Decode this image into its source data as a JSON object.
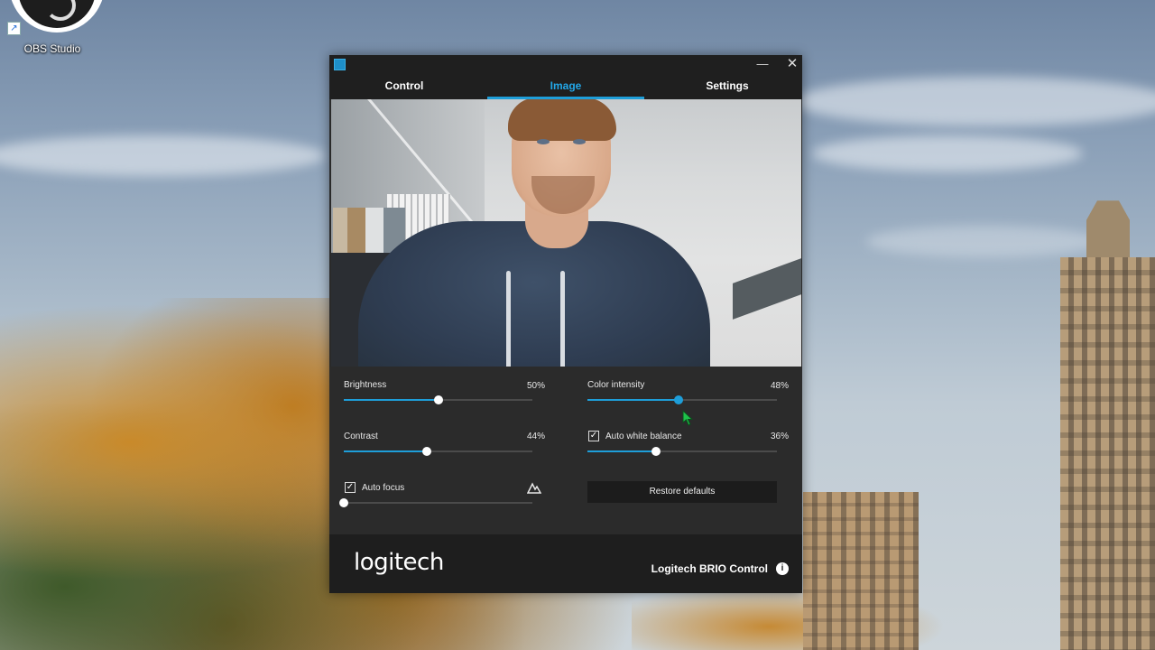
{
  "desktop": {
    "icon_label": "OBS Studio",
    "icon": "obs-studio-icon",
    "shortcut_icon": "shortcut-arrow-icon"
  },
  "window": {
    "app_icon": "logitech-app-icon",
    "min_glyph": "—",
    "close_glyph": "✕",
    "tabs": [
      {
        "label": "Control",
        "active": false
      },
      {
        "label": "Image",
        "active": true
      },
      {
        "label": "Settings",
        "active": false
      }
    ],
    "accent_color": "#1e9ed9"
  },
  "controls": {
    "brightness": {
      "label": "Brightness",
      "value_text": "50%",
      "value": 0.5
    },
    "contrast": {
      "label": "Contrast",
      "value_text": "44%",
      "value": 0.44
    },
    "auto_focus": {
      "label": "Auto focus",
      "checked": true,
      "value": 0.0,
      "icon": "focus-mountain-icon"
    },
    "color_intensity": {
      "label": "Color intensity",
      "value_text": "48%",
      "value": 0.48
    },
    "auto_white_balance": {
      "label": "Auto white balance",
      "checked": true,
      "value_text": "36%",
      "value": 0.36
    },
    "restore_defaults": "Restore defaults"
  },
  "footer": {
    "brand": "logitech",
    "product": "Logitech BRIO Control",
    "info_glyph": "i"
  }
}
